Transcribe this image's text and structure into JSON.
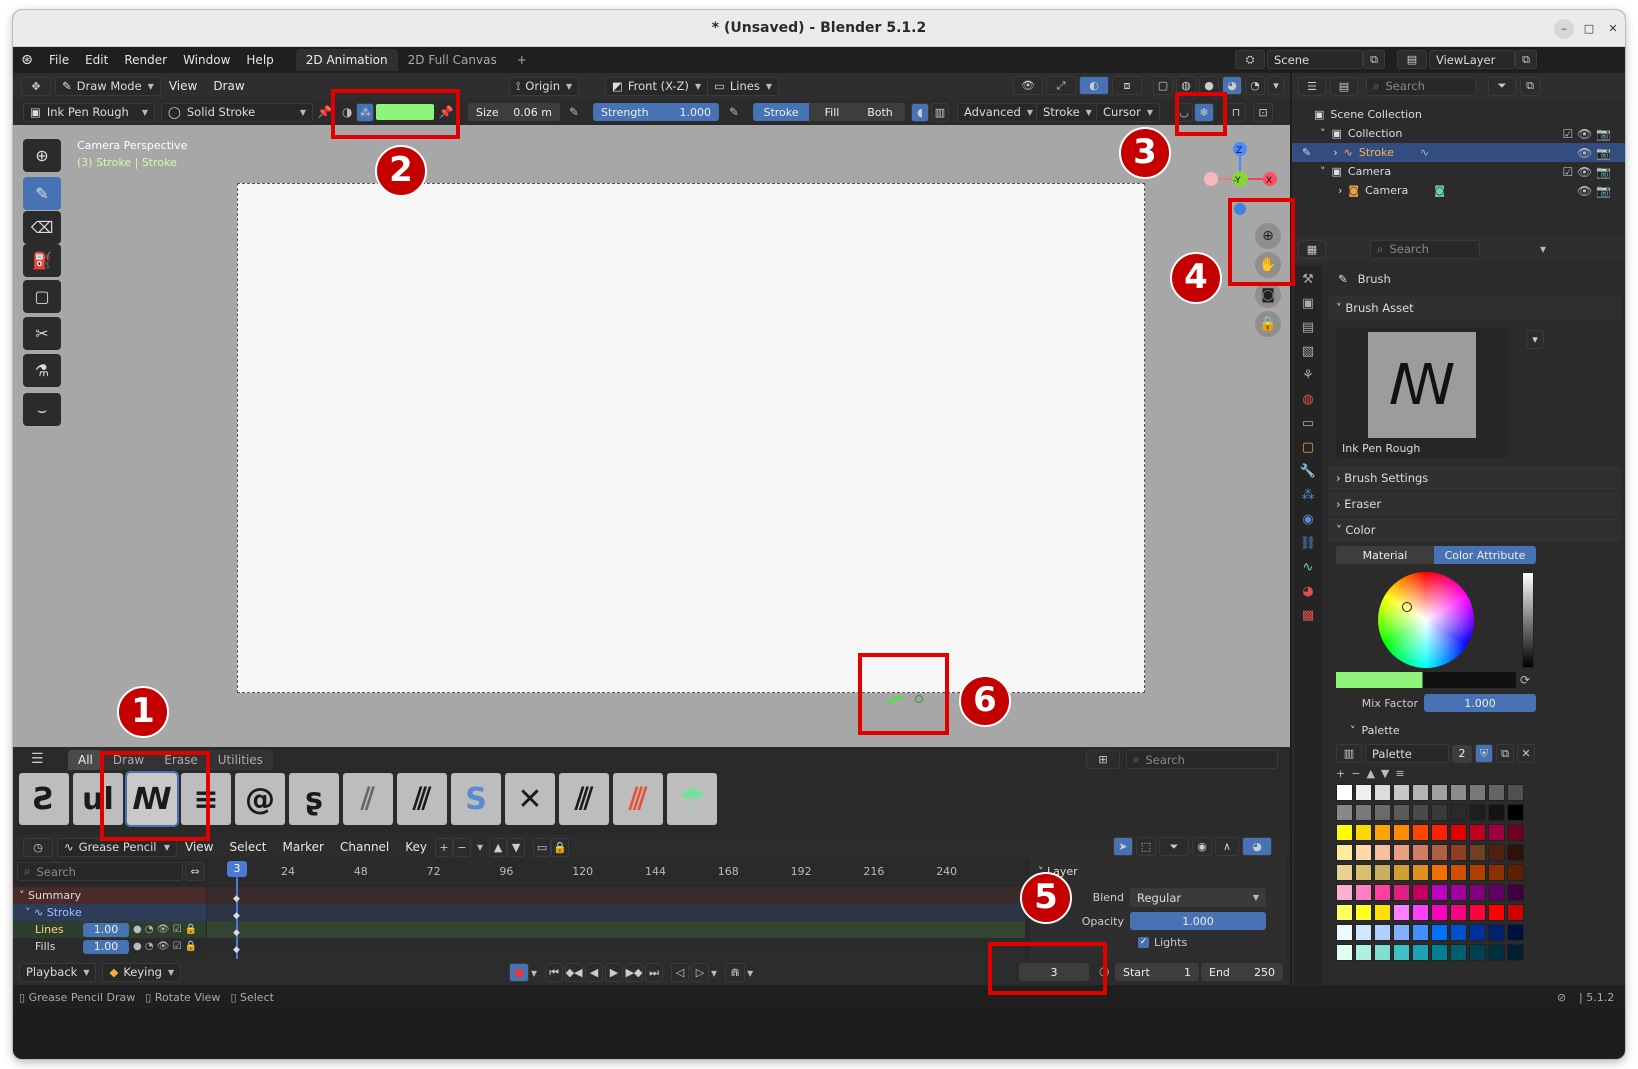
{
  "window": {
    "title": "* (Unsaved) - Blender 5.1.2",
    "controls": [
      "–",
      "□",
      "✕"
    ]
  },
  "menu": {
    "items": [
      "File",
      "Edit",
      "Render",
      "Window",
      "Help"
    ],
    "workspace_tabs": [
      "2D Animation",
      "2D Full Canvas"
    ],
    "add_tab": "+",
    "scene": "Scene",
    "view_layer": "ViewLayer"
  },
  "viewport_header": {
    "mode": "Draw Mode",
    "menus": [
      "View",
      "Draw"
    ],
    "pivot": "Origin",
    "orientation": "Front (X-Z)",
    "stroke_placement": "Lines"
  },
  "tool_header": {
    "brush": "Ink Pen Rough",
    "stroke_type": "Solid Stroke",
    "color": "#8df57a",
    "size_label": "Size",
    "size_value": "0.06 m",
    "strength_label": "Strength",
    "strength_value": "1.000",
    "mode_tabs": [
      "Stroke",
      "Fill",
      "Both"
    ],
    "dropdowns": [
      "Advanced",
      "Stroke",
      "Cursor"
    ]
  },
  "viewport": {
    "overlay_line1": "Camera Perspective",
    "overlay_line2": "(3) Stroke | Stroke",
    "gizmo": {
      "z": "Z",
      "y": "-Y",
      "x": "X"
    }
  },
  "annotations": [
    "1",
    "2",
    "3",
    "4",
    "5",
    "6"
  ],
  "asset_shelf": {
    "tabs": [
      "All",
      "Draw",
      "Erase",
      "Utilities"
    ],
    "search_placeholder": "Search"
  },
  "dopesheet": {
    "mode": "Grease Pencil",
    "menus": [
      "View",
      "Select",
      "Marker",
      "Channel",
      "Key"
    ],
    "search_placeholder": "Search",
    "current_frame_marker": "3",
    "ruler": [
      "24",
      "48",
      "72",
      "96",
      "120",
      "144",
      "168",
      "192",
      "216",
      "240"
    ],
    "channels": {
      "summary": "Summary",
      "object": "Stroke",
      "layers": [
        {
          "name": "Lines",
          "opacity": "1.00"
        },
        {
          "name": "Fills",
          "opacity": "1.00"
        }
      ]
    },
    "layer_panel": {
      "title": "Layer",
      "blend_label": "Blend",
      "blend_value": "Regular",
      "opacity_label": "Opacity",
      "opacity_value": "1.000",
      "lights_label": "Lights"
    }
  },
  "timeline": {
    "playback": "Playback",
    "keying": "Keying",
    "current_frame": "3",
    "start_label": "Start",
    "start_value": "1",
    "end_label": "End",
    "end_value": "250"
  },
  "status": {
    "items": [
      "Grease Pencil Draw",
      "Rotate View",
      "Select"
    ],
    "version": "5.1.2"
  },
  "outliner": {
    "search_placeholder": "Search",
    "items": [
      {
        "label": "Scene Collection"
      },
      {
        "label": "Collection"
      },
      {
        "label": "Stroke"
      },
      {
        "label": "Camera"
      },
      {
        "label": "Camera"
      }
    ]
  },
  "properties": {
    "search_placeholder": "Search",
    "header": "Brush",
    "brush_asset": "Brush Asset",
    "brush_name": "Ink Pen Rough",
    "panels": [
      "Brush Settings",
      "Eraser",
      "Color"
    ],
    "color_tabs": [
      "Material",
      "Color Attribute"
    ],
    "mix_factor_label": "Mix Factor",
    "mix_factor_value": "1.000",
    "palette_label": "Palette",
    "palette_name": "Palette",
    "palette_users": "2",
    "palette_colors": [
      "#ffffff",
      "#f0f0f0",
      "#dcdcdc",
      "#c8c8c8",
      "#b4b4b4",
      "#a0a0a0",
      "#8c8c8c",
      "#787878",
      "#646464",
      "#505050",
      "#888888",
      "#7a7a7a",
      "#6a6a6a",
      "#5a5a5a",
      "#4a4a4a",
      "#3a3a3a",
      "#2a2a2a",
      "#1e1e1e",
      "#141414",
      "#000000",
      "#ffff00",
      "#ffd700",
      "#ffa500",
      "#ff8c00",
      "#ff4500",
      "#ff2000",
      "#e00000",
      "#c00020",
      "#a00040",
      "#700020",
      "#ffeaa0",
      "#ffd8a8",
      "#f5c0a0",
      "#e8a080",
      "#d08060",
      "#b06040",
      "#904020",
      "#704020",
      "#502010",
      "#301008",
      "#e8d090",
      "#d8c070",
      "#c8b060",
      "#d0a030",
      "#e09020",
      "#f07000",
      "#d05000",
      "#b04000",
      "#903000",
      "#602000",
      "#ffb0d0",
      "#ff80c0",
      "#ff40a0",
      "#e02080",
      "#c00060",
      "#c000c0",
      "#a000a0",
      "#800080",
      "#600060",
      "#400040",
      "#ffff60",
      "#ffff20",
      "#ffe000",
      "#ff80ff",
      "#ff40ff",
      "#ff00c0",
      "#ff0080",
      "#ff0040",
      "#ff0000",
      "#d00000",
      "#f0f8ff",
      "#d0e8ff",
      "#b0d0ff",
      "#80b0ff",
      "#4090ff",
      "#0070ff",
      "#0050d0",
      "#0030a0",
      "#002070",
      "#001040",
      "#e0fff0",
      "#b0f0e0",
      "#80e0d0",
      "#40c0c0",
      "#20a0b0",
      "#008090",
      "#006070",
      "#004050",
      "#003040",
      "#002030"
    ]
  }
}
